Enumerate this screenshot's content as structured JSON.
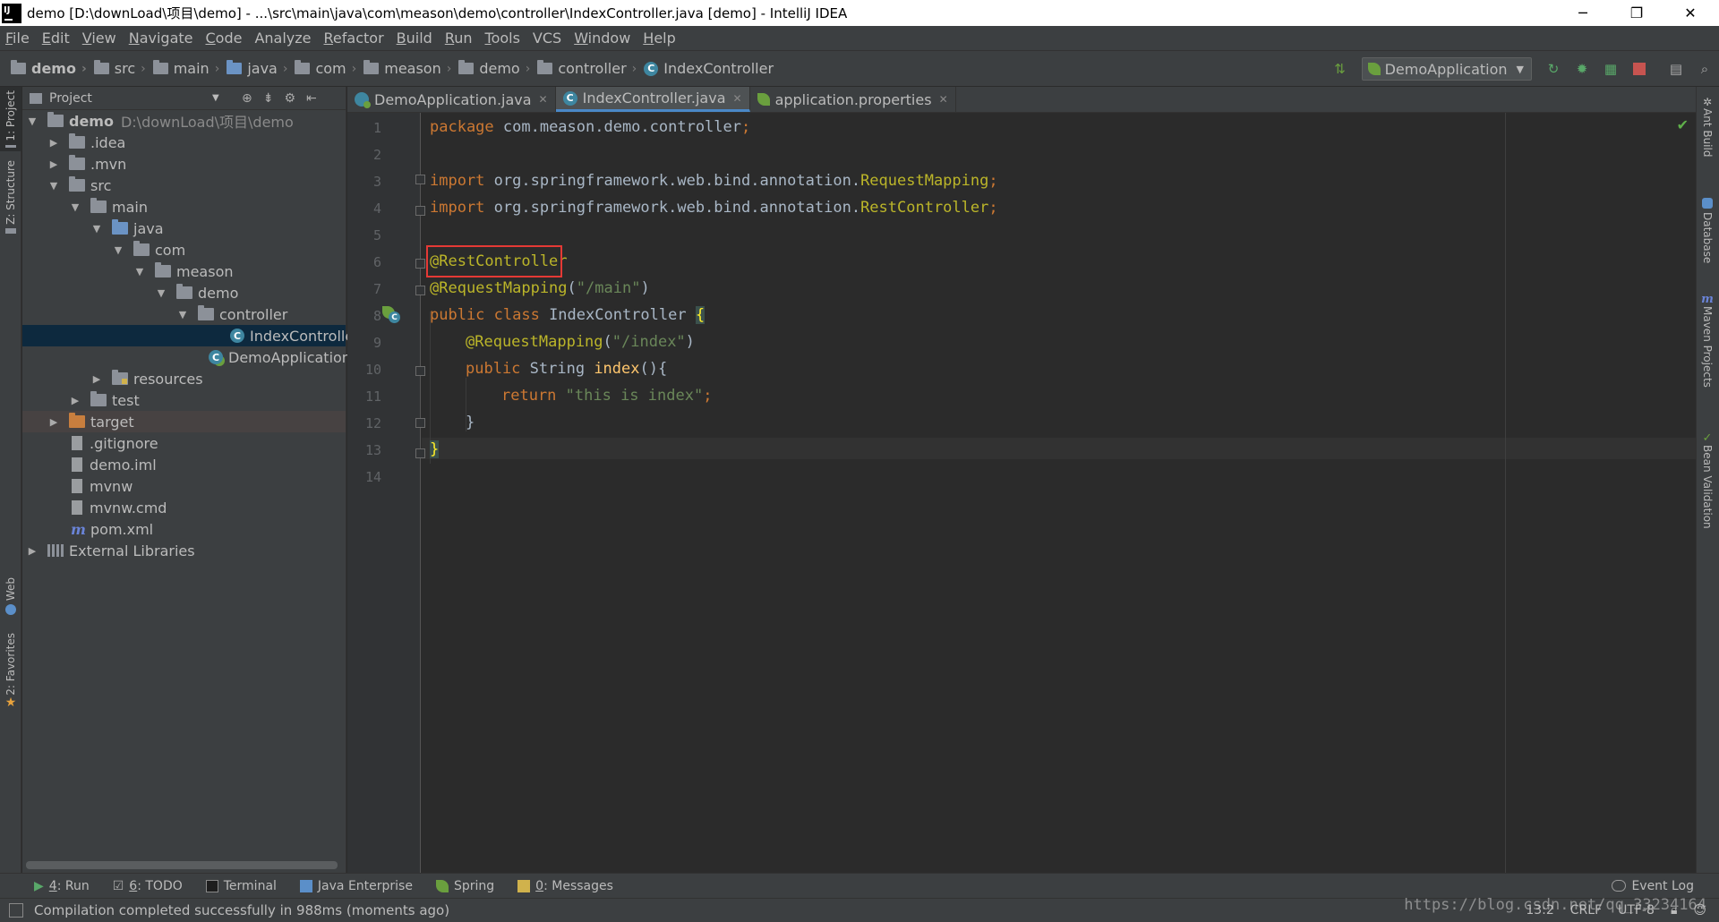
{
  "window": {
    "title": "demo [D:\\downLoad\\项目\\demo] - ...\\src\\main\\java\\com\\meason\\demo\\controller\\IndexController.java [demo] - IntelliJ IDEA",
    "minimize": "─",
    "restore": "❐",
    "close": "✕"
  },
  "menu": [
    {
      "label": "File",
      "mn": "F",
      "rest": "ile"
    },
    {
      "label": "Edit",
      "mn": "E",
      "rest": "dit"
    },
    {
      "label": "View",
      "mn": "V",
      "rest": "iew"
    },
    {
      "label": "Navigate",
      "mn": "N",
      "rest": "avigate"
    },
    {
      "label": "Code",
      "mn": "C",
      "rest": "ode"
    },
    {
      "label": "Analyze",
      "mn": "",
      "rest": "Analyze"
    },
    {
      "label": "Refactor",
      "mn": "R",
      "rest": "efactor"
    },
    {
      "label": "Build",
      "mn": "B",
      "rest": "uild"
    },
    {
      "label": "Run",
      "mn": "R",
      "rest": "un"
    },
    {
      "label": "Tools",
      "mn": "T",
      "rest": "ools"
    },
    {
      "label": "VCS",
      "mn": "",
      "rest": "VCS"
    },
    {
      "label": "Window",
      "mn": "W",
      "rest": "indow"
    },
    {
      "label": "Help",
      "mn": "H",
      "rest": "elp"
    }
  ],
  "breadcrumbs": [
    "demo",
    "src",
    "main",
    "java",
    "com",
    "meason",
    "demo",
    "controller",
    "IndexController"
  ],
  "toolbar": {
    "run_config": "DemoApplication"
  },
  "left_strip": {
    "project": "1: Project",
    "structure": "Z: Structure",
    "web": "Web",
    "favorites": "2: Favorites"
  },
  "right_strip": {
    "ant": "Ant Build",
    "database": "Database",
    "maven": "Maven Projects",
    "bean": "Bean Validation"
  },
  "project_panel": {
    "title": "Project",
    "root_name": "demo",
    "root_path": "D:\\downLoad\\项目\\demo",
    "items": [
      {
        "name": ".idea"
      },
      {
        "name": ".mvn"
      },
      {
        "name": "src"
      },
      {
        "name": "main"
      },
      {
        "name": "java"
      },
      {
        "name": "com"
      },
      {
        "name": "meason"
      },
      {
        "name": "demo"
      },
      {
        "name": "controller"
      },
      {
        "name": "IndexController"
      },
      {
        "name": "DemoApplication"
      },
      {
        "name": "resources"
      },
      {
        "name": "test"
      },
      {
        "name": "target"
      },
      {
        "name": ".gitignore"
      },
      {
        "name": "demo.iml"
      },
      {
        "name": "mvnw"
      },
      {
        "name": "mvnw.cmd"
      },
      {
        "name": "pom.xml"
      },
      {
        "name": "External Libraries"
      }
    ]
  },
  "tabs": [
    {
      "label": "DemoApplication.java"
    },
    {
      "label": "IndexController.java"
    },
    {
      "label": "application.properties"
    }
  ],
  "editor": {
    "line_numbers": [
      "1",
      "2",
      "3",
      "4",
      "5",
      "6",
      "7",
      "8",
      "9",
      "10",
      "11",
      "12",
      "13",
      "14"
    ],
    "code": {
      "l1_kw": "package ",
      "l1_rest": "com.meason.demo.controller",
      "l1_semi": ";",
      "l3_kw": "import ",
      "l3_pkg": "org.springframework.web.bind.annotation.",
      "l3_cls": "RequestMapping",
      "l3_semi": ";",
      "l4_kw": "import ",
      "l4_pkg": "org.springframework.web.bind.annotation.",
      "l4_cls": "RestController",
      "l4_semi": ";",
      "l6_ann": "@RestController",
      "l7_ann": "@RequestMapping",
      "l7_open": "(",
      "l7_str": "\"/main\"",
      "l7_close": ")",
      "l8_kw": "public class ",
      "l8_name": "IndexController ",
      "l8_brace": "{",
      "l9_ann": "@RequestMapping",
      "l9_open": "(",
      "l9_str": "\"/index\"",
      "l9_close": ")",
      "l10_kw": "public ",
      "l10_type": "String ",
      "l10_fn": "index",
      "l10_rest": "(){",
      "l11_kw": "return ",
      "l11_str": "\"this is index\"",
      "l11_semi": ";",
      "l12": "}",
      "l13": "}"
    }
  },
  "bottom_tabs": [
    {
      "num": "4",
      "label": ": Run"
    },
    {
      "num": "6",
      "label": ": TODO"
    },
    {
      "num": "",
      "label": "Terminal"
    },
    {
      "num": "",
      "label": "Java Enterprise"
    },
    {
      "num": "",
      "label": "Spring"
    },
    {
      "num": "0",
      "label": ": Messages"
    }
  ],
  "event_log": "Event Log",
  "status": {
    "message": "Compilation completed successfully in 988ms (moments ago)",
    "position": "13:2",
    "line_sep": "CRLF",
    "encoding": "UTF-8",
    "watermark": "https://blog.csdn.net/qq_33234164"
  },
  "colors": {
    "keyword": "#cc7832",
    "annotation": "#bbb529",
    "string": "#6a8759",
    "method": "#ffc66d",
    "highlight_box": "#e53935",
    "selection": "#0d293e"
  }
}
